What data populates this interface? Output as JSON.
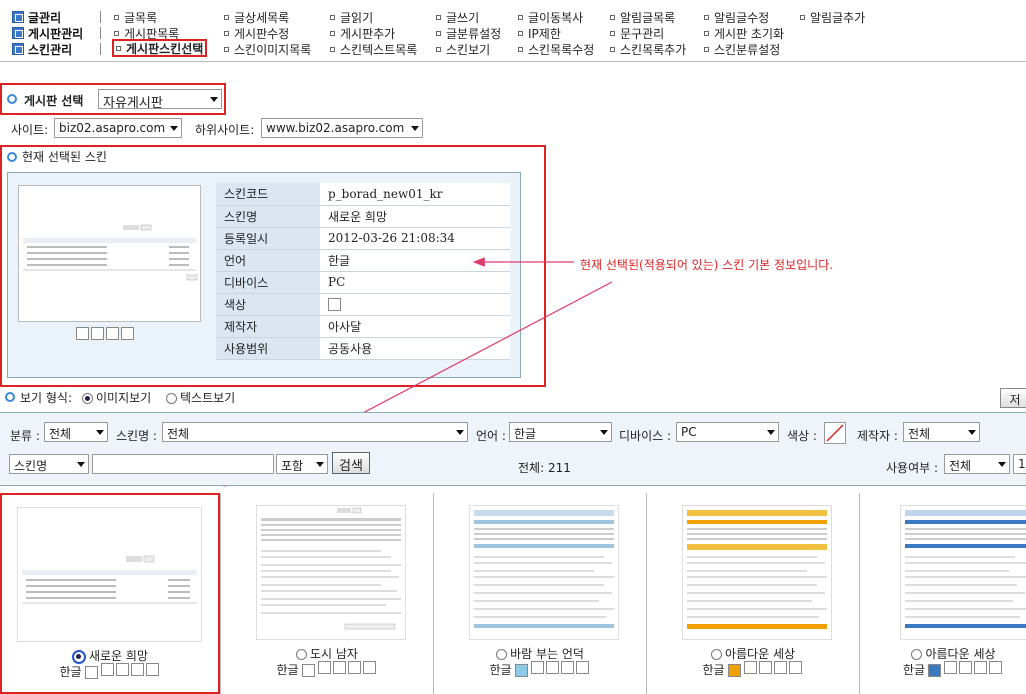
{
  "menu": {
    "categories": [
      {
        "label": "글관리"
      },
      {
        "label": "게시판관리"
      },
      {
        "label": "스킨관리"
      }
    ],
    "row1": [
      "글목록",
      "글상세목록",
      "글읽기",
      "글쓰기",
      "글이동복사",
      "알림글목록",
      "알림글수정",
      "알림글추가"
    ],
    "row2": [
      "게시판목록",
      "게시판수정",
      "게시판추가",
      "글분류설정",
      "IP제한",
      "문구관리",
      "게시판 초기화"
    ],
    "row3": [
      "게시판스킨선택",
      "스킨이미지목록",
      "스킨텍스트목록",
      "스킨보기",
      "스킨목록수정",
      "스킨목록추가",
      "스킨분류설정"
    ]
  },
  "board_select": {
    "label": "게시판 선택",
    "value": "자유게시판"
  },
  "site": {
    "label": "사이트:",
    "value": "biz02.asapro.com",
    "sub_label": "하위사이트:",
    "sub_value": "www.biz02.asapro.com"
  },
  "current_skin": {
    "title": "현재 선택된 스킨",
    "rows": [
      {
        "key": "스킨코드",
        "value": "p_borad_new01_kr"
      },
      {
        "key": "스킨명",
        "value": "새로운 희망"
      },
      {
        "key": "등록일시",
        "value": "2012-03-26 21:08:34"
      },
      {
        "key": "언어",
        "value": "한글"
      },
      {
        "key": "디바이스",
        "value": "PC"
      },
      {
        "key": "색상",
        "value": ""
      },
      {
        "key": "제작자",
        "value": "아사달"
      },
      {
        "key": "사용범위",
        "value": "공동사용"
      }
    ]
  },
  "annotation": "현재 선택된(적용되어 있는) 스킨 기본 정보입니다.",
  "view_type": {
    "label": "보기 형식:",
    "options": [
      "이미지보기",
      "텍스트보기"
    ],
    "selected": "이미지보기",
    "right_button": "저"
  },
  "filters": {
    "category_label": "분류 :",
    "category_value": "전체",
    "skin_name_label": "스킨명 :",
    "skin_name_value": "전체",
    "lang_label": "언어 :",
    "lang_value": "한글",
    "device_label": "디바이스 :",
    "device_value": "PC",
    "color_label": "색상 :",
    "maker_label": "제작자 :",
    "maker_value": "전체",
    "search_field": "스킨명",
    "search_value": "",
    "match": "포함",
    "search_button": "검색",
    "total": "전체: 211",
    "use_label": "사용여부 :",
    "use_value": "전체",
    "page_size": "1"
  },
  "skins": [
    {
      "name": "새로운 희망",
      "lang": "한글",
      "color": "#ffffff",
      "selected": true
    },
    {
      "name": "도시 남자",
      "lang": "한글",
      "color": "#ffffff",
      "selected": false
    },
    {
      "name": "바람 부는 언덕",
      "lang": "한글",
      "color": "#8ccbe8",
      "selected": false
    },
    {
      "name": "아름다운 세상",
      "lang": "한글",
      "color": "#f0a000",
      "selected": false
    },
    {
      "name": "아름다운 세상",
      "lang": "한글",
      "color": "#3a78c0",
      "selected": false
    }
  ]
}
